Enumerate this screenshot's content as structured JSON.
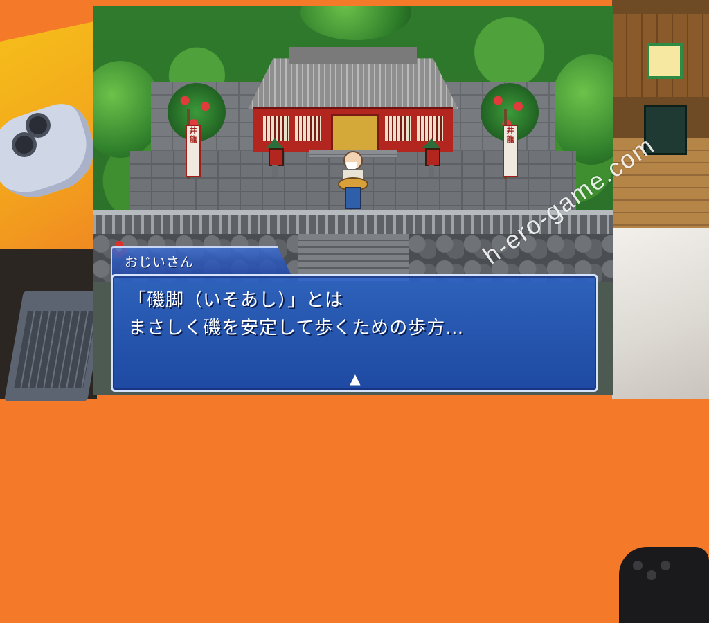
{
  "dialogue": {
    "speaker": "おじいさん",
    "lines": [
      "「磯脚（いそあし）」とは",
      "まさしく磯を安定して歩くための歩方…"
    ],
    "continue_indicator": "▲"
  },
  "scene": {
    "banner_text_left": "井龍",
    "banner_text_right": "井龍"
  },
  "watermark": "h-ero-game.com",
  "colors": {
    "dialogue_bg": "#2a5fc8",
    "dialogue_border": "#d7e2fb",
    "accent_orange": "#f47a2a"
  }
}
